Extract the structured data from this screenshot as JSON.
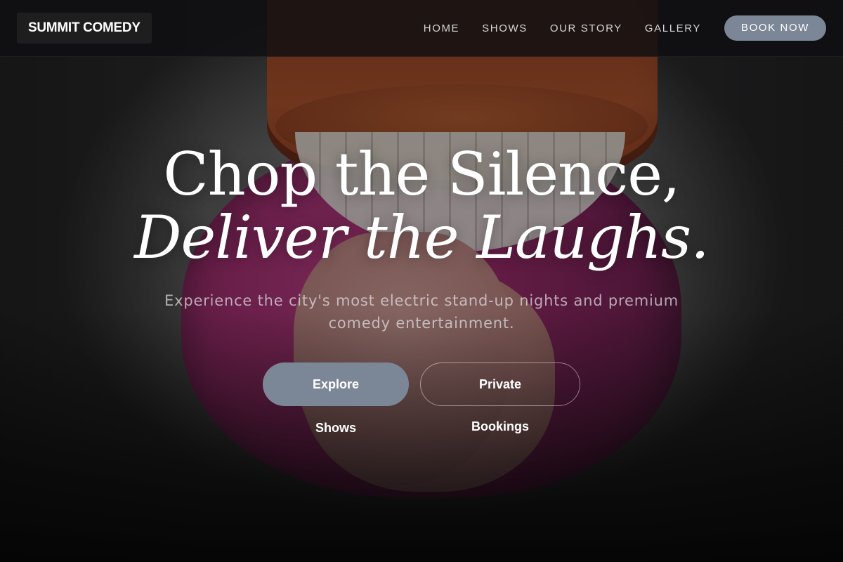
{
  "brand": {
    "name": "SUMMIT COMEDY"
  },
  "nav": {
    "items": [
      {
        "label": "HOME"
      },
      {
        "label": "SHOWS"
      },
      {
        "label": "OUR STORY"
      },
      {
        "label": "GALLERY"
      }
    ],
    "cta_label": "BOOK NOW"
  },
  "hero": {
    "headline_line1": "Chop the Silence,",
    "headline_line2": "Deliver the Laughs.",
    "subheadline": "Experience the city's most electric stand-up nights and premium comedy entertainment.",
    "primary_button": "Explore Shows",
    "secondary_button": "Private Bookings",
    "background_image": "chattering-teeth-toy-photo"
  },
  "colors": {
    "accent": "#7b8696",
    "header_bg": "#0f0f11",
    "text_light": "#ffffff"
  }
}
